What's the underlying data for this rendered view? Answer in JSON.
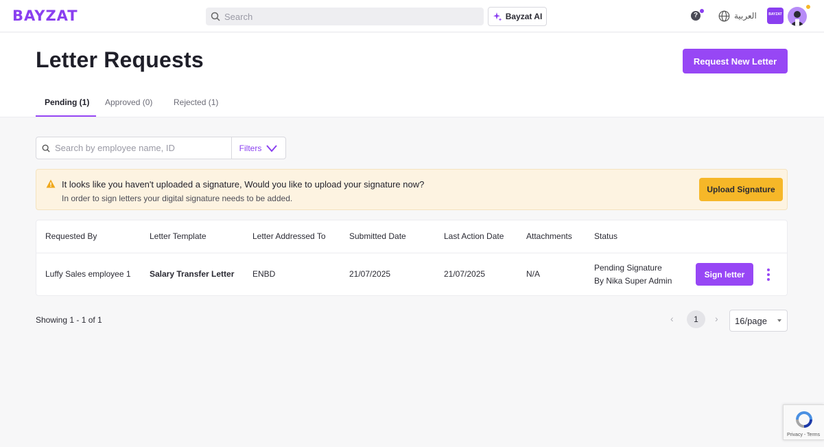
{
  "nav": {
    "logo": "BAYZAT",
    "search_placeholder": "Search",
    "ai_button": "Bayzat AI",
    "help_icon": "question-icon",
    "language": "العربية",
    "company_logo_text": "BAYZAT"
  },
  "header": {
    "title": "Letter Requests",
    "request_button": "Request New Letter",
    "tabs": [
      {
        "label": "Pending (1)",
        "active": true
      },
      {
        "label": "Approved (0)",
        "active": false
      },
      {
        "label": "Rejected (1)",
        "active": false
      }
    ]
  },
  "filters": {
    "search_placeholder": "Search by employee name, ID",
    "filters_label": "Filters"
  },
  "alert": {
    "title": "It looks like you haven't uploaded a signature, Would you like to upload your signature now?",
    "description": "In order to sign letters your digital signature needs to be added.",
    "button": "Upload Signature"
  },
  "table": {
    "columns": [
      "Requested By",
      "Letter Template",
      "Letter Addressed To",
      "Submitted Date",
      "Last Action Date",
      "Attachments",
      "Status"
    ],
    "rows": [
      {
        "requested_by": "Luffy Sales employee 1",
        "letter_template": "Salary Transfer Letter",
        "addressed_to": "ENBD",
        "submitted_date": "21/07/2025",
        "last_action_date": "21/07/2025",
        "attachments": "N/A",
        "status_line1": "Pending Signature",
        "status_line2": "By Nika Super Admin",
        "action_button": "Sign letter"
      }
    ]
  },
  "pagination": {
    "showing": "Showing 1 - 1 of 1",
    "current_page": "1",
    "per_page": "16/page"
  },
  "recaptcha": {
    "text": "Privacy - Terms"
  },
  "colors": {
    "primary": "#9747f5",
    "warning": "#f6b728",
    "alert_bg": "#fdf3e1"
  }
}
